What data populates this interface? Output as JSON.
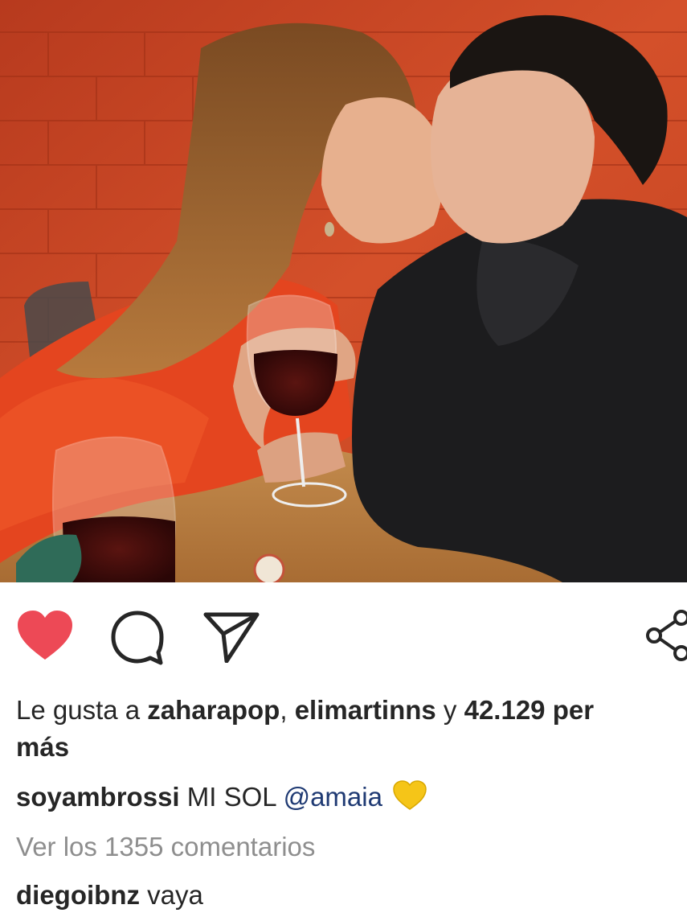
{
  "post": {
    "likes": {
      "prefix": "Le gusta a",
      "user1": "zaharapop",
      "separator": ",",
      "user2": "elimartinns",
      "conjunction": "y",
      "count": "42.129 per",
      "more": "más"
    },
    "caption": {
      "username": "soyambrossi",
      "text": "MI SOL",
      "mention": "@amaia",
      "emoji": "yellow-heart"
    },
    "view_comments": "Ver los 1355 comentarios",
    "comment": {
      "username": "diegoibnz",
      "text": "vaya"
    }
  },
  "actions": {
    "like_icon": "heart-filled-icon",
    "comment_icon": "speech-bubble-icon",
    "share_icon": "paper-plane-icon",
    "other_icon": "share-nodes-icon"
  },
  "colors": {
    "like": "#ed4956",
    "mention": "#1f3a73",
    "secondary_text": "#8e8e8e",
    "emoji": "#f5c518"
  }
}
